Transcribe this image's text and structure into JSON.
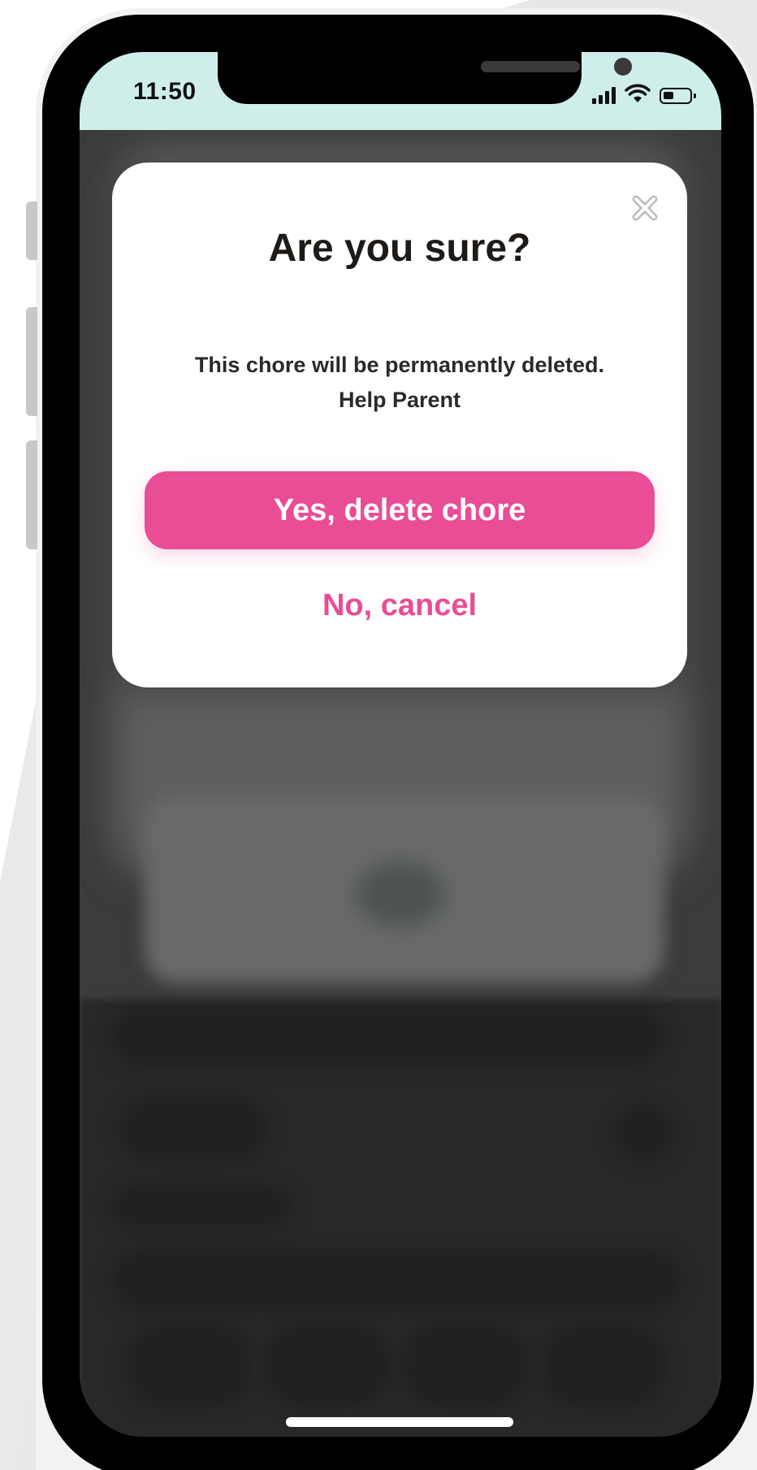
{
  "status_bar": {
    "time": "11:50",
    "battery_level": 0.4,
    "icons": [
      "signal-icon",
      "wifi-icon",
      "battery-icon"
    ]
  },
  "dialog": {
    "close_icon": "close-icon",
    "title": "Are you sure?",
    "message_line1": "This chore will be permanently deleted.",
    "message_line2": "Help Parent",
    "confirm_label": "Yes, delete chore",
    "cancel_label": "No, cancel"
  },
  "colors": {
    "accent": "#e94d96",
    "status_bar_bg": "#cfeee9",
    "title_text": "#1d1a17",
    "overlay": "#3b3b3b"
  }
}
